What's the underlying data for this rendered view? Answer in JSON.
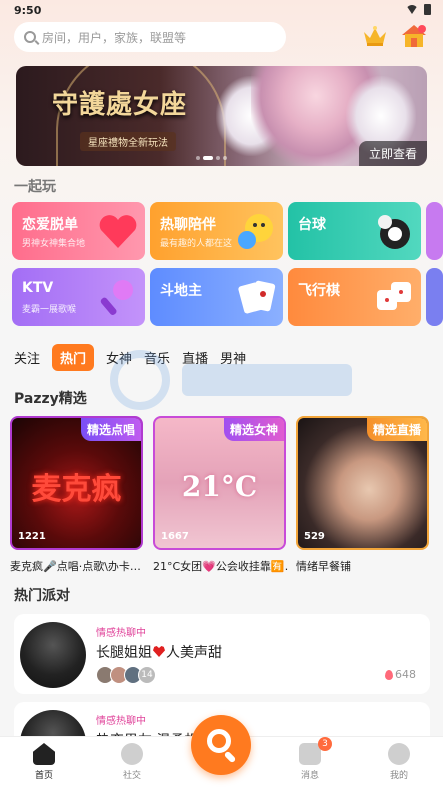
{
  "status_bar": {
    "time": "9:50"
  },
  "search": {
    "placeholder": "房间，用户，家族，联盟等"
  },
  "banner": {
    "title": "守護處女座",
    "subtitle": "星座禮物全新玩法",
    "button": "立即查看"
  },
  "section_play": {
    "title": "一起玩"
  },
  "play_cards": [
    {
      "title": "恋爱脱单",
      "subtitle": "男神女神集合地"
    },
    {
      "title": "热聊陪伴",
      "subtitle": "最有趣的人都在这"
    },
    {
      "title": "台球",
      "subtitle": ""
    },
    {
      "title": "KTV",
      "subtitle": "麦霸一展歌喉"
    },
    {
      "title": "斗地主",
      "subtitle": ""
    },
    {
      "title": "飞行棋",
      "subtitle": ""
    }
  ],
  "tabs": [
    "关注",
    "热门",
    "女神",
    "音乐",
    "直播",
    "男神"
  ],
  "active_tab": "热门",
  "section_picks": {
    "title": "Pazzy精选"
  },
  "picks": [
    {
      "badge": "精选点唱",
      "art_text": "麦克疯",
      "count": "1221",
      "caption": "麦克疯🎤点唱·点歌\\办卡…"
    },
    {
      "badge": "精选女神",
      "art_text": "21°C",
      "count": "1667",
      "caption": "21°C女团💗公会收挂靠🈶…"
    },
    {
      "badge": "精选直播",
      "art_text": "",
      "count": "529",
      "caption": "情绪早餐铺"
    }
  ],
  "section_party": {
    "title": "热门派对"
  },
  "parties": [
    {
      "tag": "情感热聊中",
      "name_pre": "长腿姐姐",
      "name_post": "人美声甜",
      "extra_count": "14",
      "heat": "648"
    },
    {
      "tag": "情感热聊中",
      "name_pre": "热恋男友 温柔相伴",
      "name_post": "",
      "extra_count": "",
      "heat": ""
    }
  ],
  "tabbar": {
    "home": "首页",
    "social": "社交",
    "messages": "消息",
    "me": "我的",
    "message_badge": "3"
  },
  "colors": {
    "accent": "#ff7a1f",
    "tag_pink": "#e0439a"
  }
}
